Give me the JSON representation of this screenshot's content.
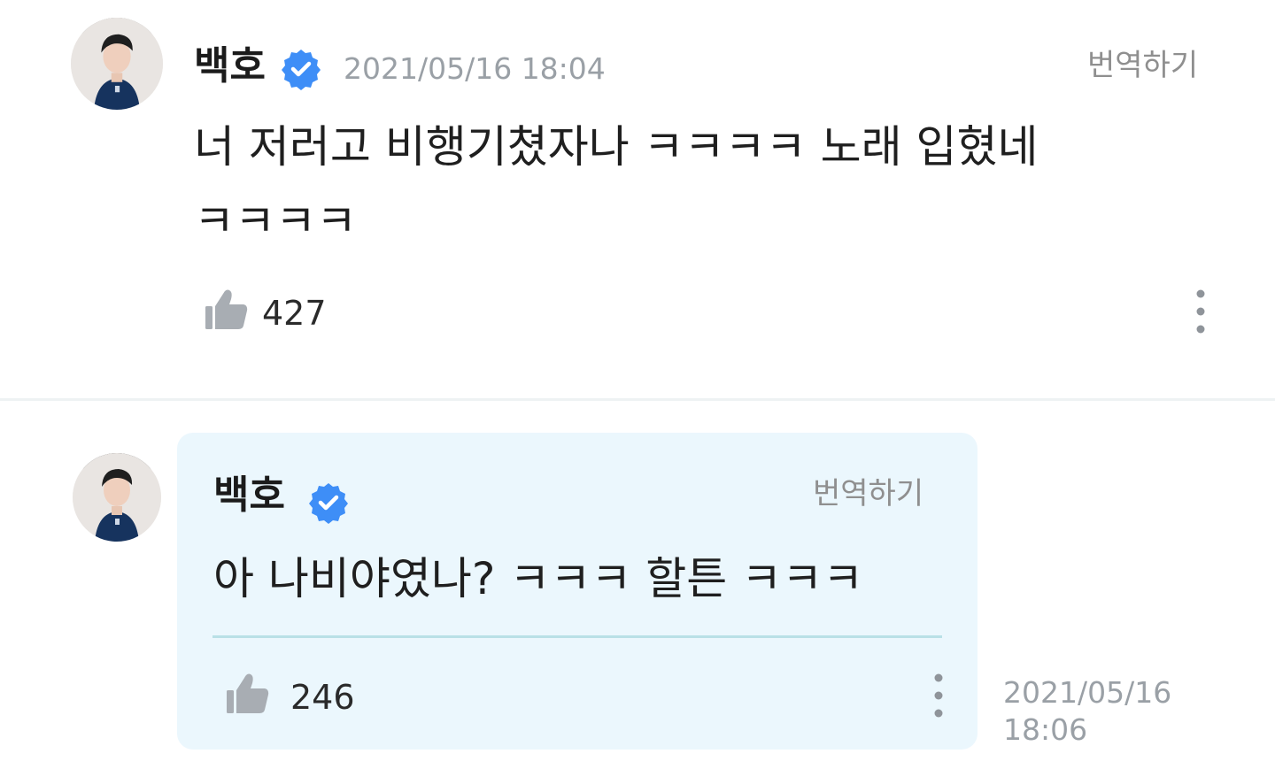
{
  "post": {
    "author": "백호",
    "verified_icon": "verified-check-icon",
    "timestamp": "2021/05/16 18:04",
    "translate_label": "번역하기",
    "content_line1": "너 저러고 비행기쳤자나 ㅋㅋㅋㅋ 노래 입혔네",
    "content_line2": "ㅋㅋㅋㅋ",
    "likes": "427",
    "like_icon": "thumbs-up-icon",
    "more_icon": "more-vertical-icon"
  },
  "reply": {
    "author": "백호",
    "verified_icon": "verified-check-icon",
    "translate_label": "번역하기",
    "content": "아 나비야였나? ㅋㅋㅋ 할튼 ㅋㅋㅋ",
    "likes": "246",
    "like_icon": "thumbs-up-icon",
    "more_icon": "more-vertical-icon",
    "timestamp_date": "2021/05/16",
    "timestamp_time": "18:06"
  },
  "colors": {
    "verified_blue": "#3e8ef7",
    "reply_bg": "#ebf7fd",
    "icon_gray": "#a8adb3"
  }
}
